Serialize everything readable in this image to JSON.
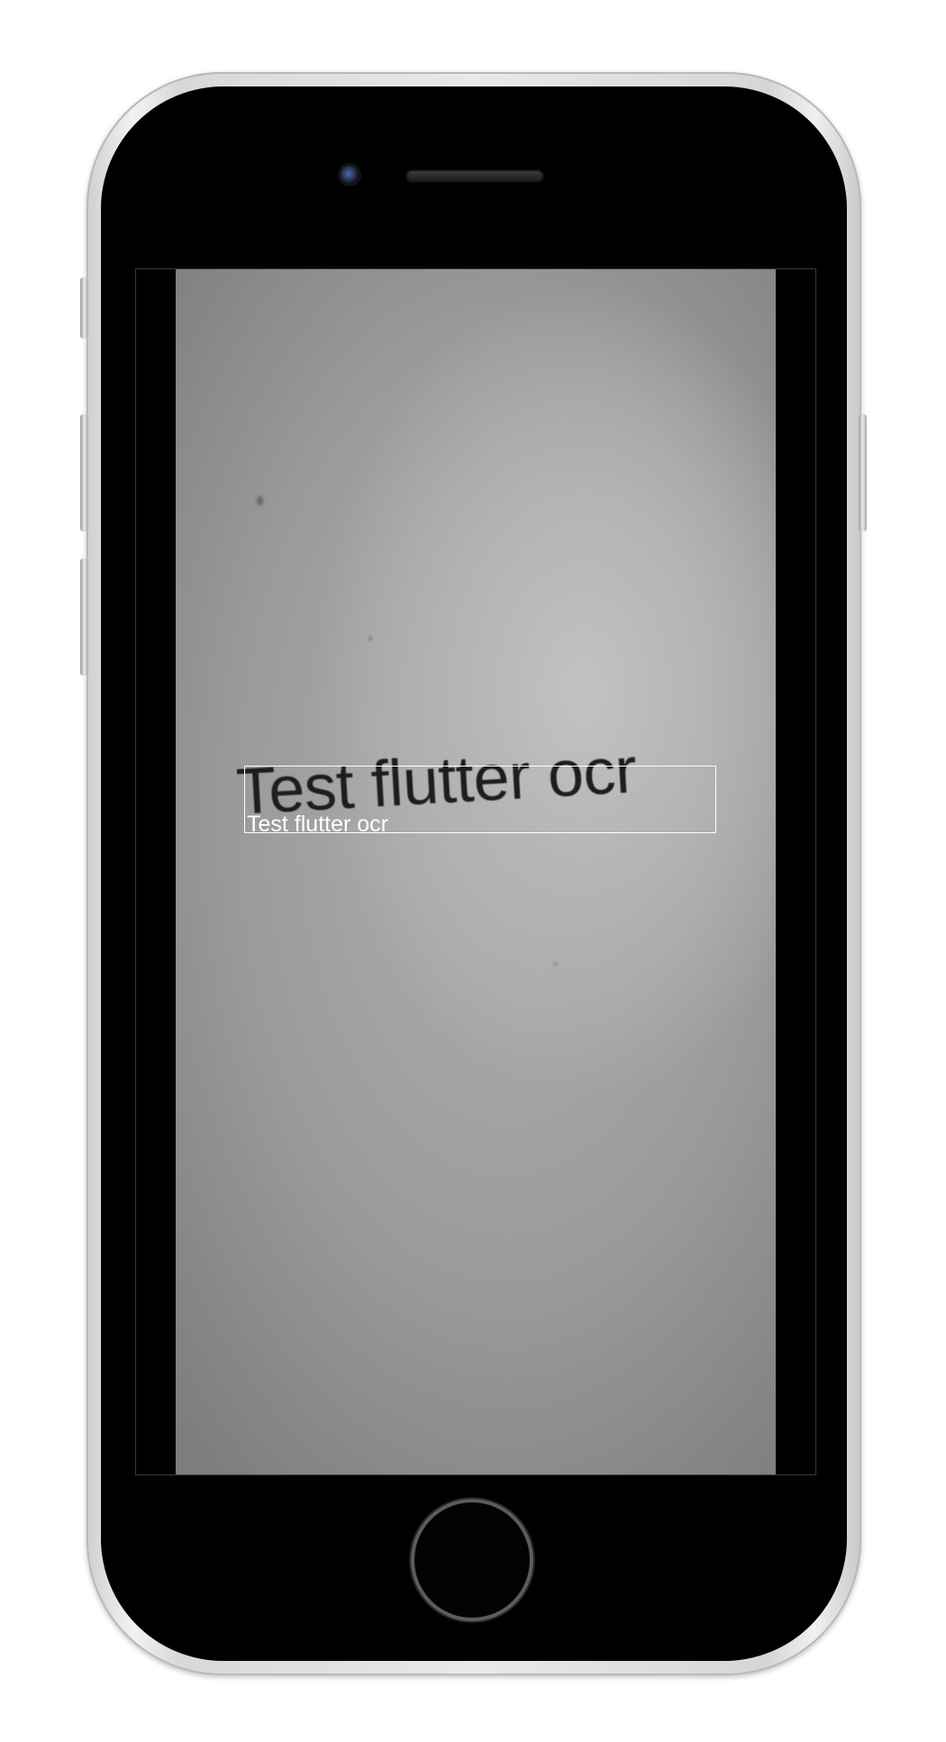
{
  "device": {
    "model_icon": "iphone-frame-icon"
  },
  "camera_view": {
    "scene_text": "Test flutter ocr"
  },
  "ocr_overlay": {
    "detections": [
      {
        "text": "Test flutter ocr"
      }
    ],
    "box_color": "#ffffff",
    "label_color": "#ffffff"
  }
}
